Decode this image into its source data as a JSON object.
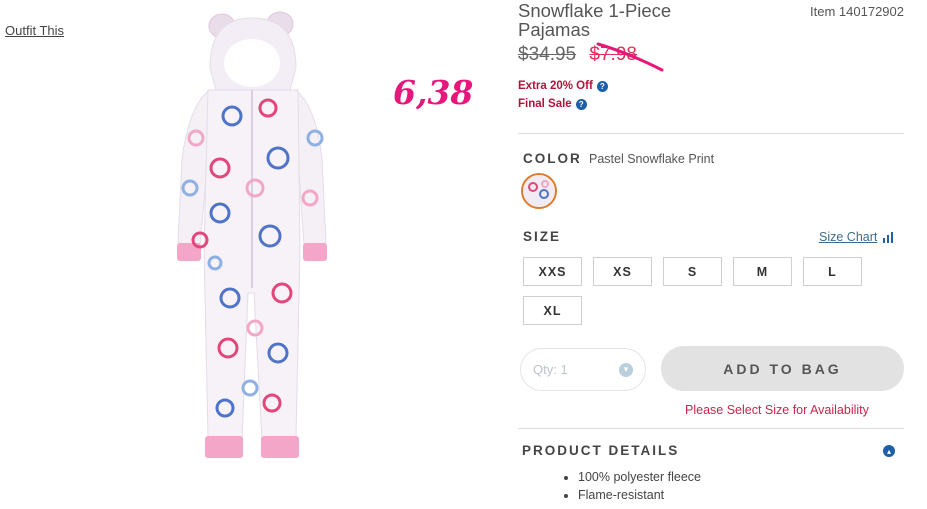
{
  "nav": {
    "outfit_link": "Outfit This"
  },
  "annotation": {
    "handwritten_price": "6,38"
  },
  "product": {
    "title": "Snowflake 1-Piece Pajamas",
    "item_number": "Item 140172902",
    "old_price": "$34.95",
    "sale_price": "$7.98",
    "promos": [
      "Extra 20% Off",
      "Final Sale"
    ]
  },
  "color": {
    "label": "COLOR",
    "value": "Pastel Snowflake Print"
  },
  "size": {
    "label": "SIZE",
    "chart_link": "Size Chart",
    "options": [
      "XXS",
      "XS",
      "S",
      "M",
      "L",
      "XL"
    ]
  },
  "purchase": {
    "qty_label": "Qty: 1",
    "add_button": "ADD TO BAG",
    "warning": "Please Select Size for Availability"
  },
  "details": {
    "label": "PRODUCT DETAILS",
    "items": [
      "100% polyester fleece",
      "Flame-resistant"
    ]
  },
  "colors": {
    "accent_pink": "#e2305a",
    "promo_red": "#b3133a",
    "help_blue": "#1d5fa8",
    "swatch_ring": "#e07a2a"
  }
}
